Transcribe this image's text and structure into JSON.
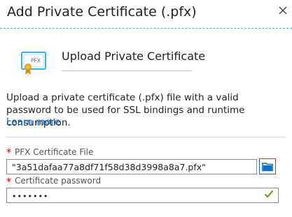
{
  "blade": {
    "title": "Add Private Certificate (.pfx)"
  },
  "hero": {
    "title": "Upload Private Certificate",
    "icon_label": "PFX"
  },
  "description": {
    "text": "Upload a private certificate (.pfx) file with a valid password to be used for SSL bindings and runtime consumption.",
    "learn_more": "Learn more"
  },
  "form": {
    "required_marker": "*",
    "pfx_file": {
      "label": "PFX Certificate File",
      "value": "\"3a51dafaa77a8df71f58d38d3998a8a7.pfx\""
    },
    "password": {
      "label": "Certificate password",
      "value": "•••••••"
    }
  },
  "colors": {
    "accent": "#0a6ccf",
    "required": "#d40000",
    "valid": "#57a300",
    "header_border": "#3fb3d9"
  },
  "icons": {
    "close": "close-icon",
    "certificate": "certificate-icon",
    "folder": "folder-icon",
    "check": "checkmark-icon"
  }
}
